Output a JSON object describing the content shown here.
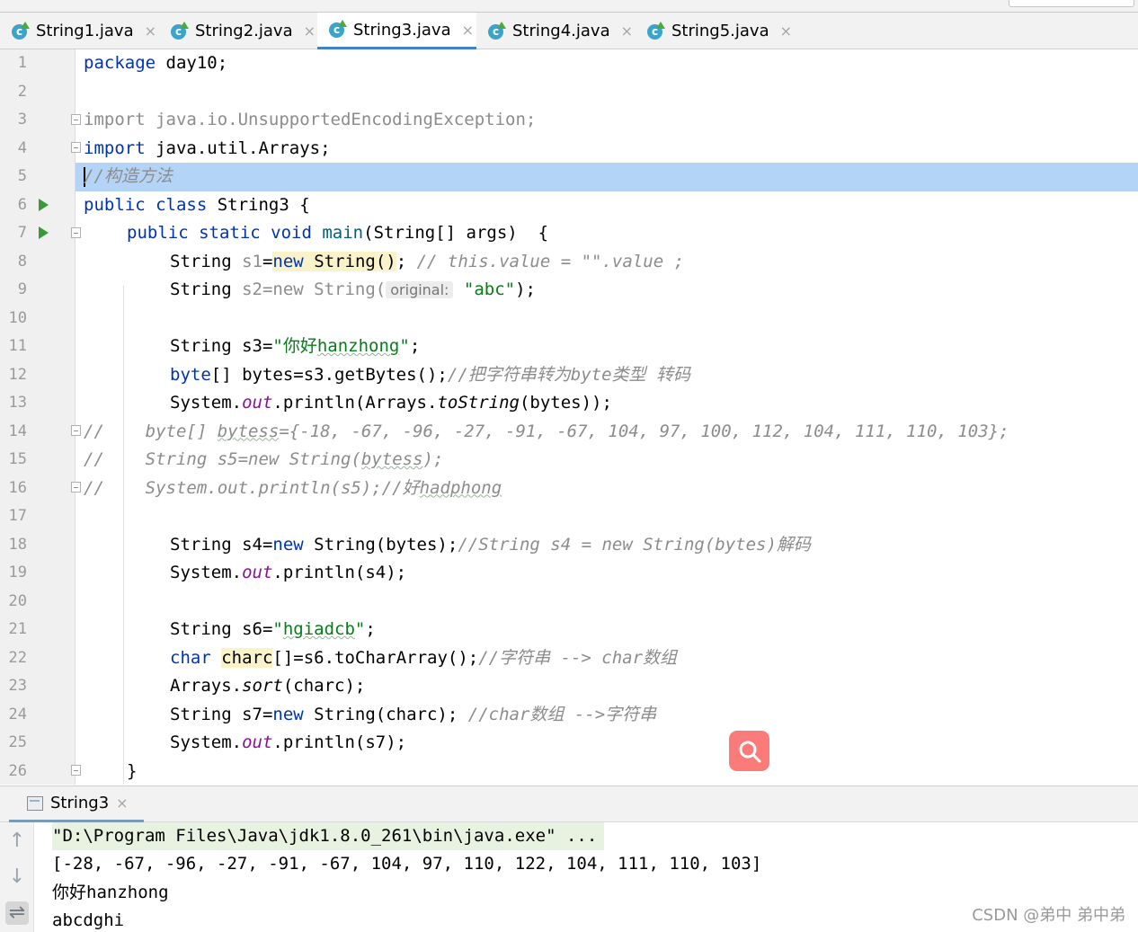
{
  "tabs": [
    {
      "label": "String1.java",
      "active": false
    },
    {
      "label": "String2.java",
      "active": false
    },
    {
      "label": "String3.java",
      "active": true
    },
    {
      "label": "String4.java",
      "active": false
    },
    {
      "label": "String5.java",
      "active": false
    }
  ],
  "tab_close_glyph": "×",
  "line_numbers": [
    "1",
    "2",
    "3",
    "4",
    "5",
    "6",
    "7",
    "8",
    "9",
    "10",
    "11",
    "12",
    "13",
    "14",
    "15",
    "16",
    "17",
    "18",
    "19",
    "20",
    "21",
    "22",
    "23",
    "24",
    "25",
    "26"
  ],
  "code": {
    "l1": {
      "kw": "package",
      "rest": " day10;"
    },
    "l3": {
      "kw": "import",
      "rest": " java.io.UnsupportedEncodingException;"
    },
    "l4": {
      "kw": "import",
      "rest": " java.util.Arrays;"
    },
    "l5": {
      "comment": "//构造方法"
    },
    "l6": {
      "kw": "public class",
      "rest": " String3 {"
    },
    "l7": {
      "kw": "public static void",
      "name": "main",
      "rest": "(String[] args)  {"
    },
    "l8": {
      "a": "String ",
      "var": "s1",
      "b": "=",
      "kw": "new",
      "hl": " String()",
      "c": "; ",
      "comment": "// this.value = \"\".value ;"
    },
    "l9": {
      "a": "String ",
      "var": "s2",
      "b": "=new String(",
      "hint": "original:",
      "str": "\"abc\"",
      "c": ");"
    },
    "l11": {
      "a": "String s3=",
      "str1": "\"你好",
      "str2": "hanzhong",
      "str3": "\"",
      "c": ";"
    },
    "l12": {
      "kw": "byte",
      "a": "[] bytes=s3.getBytes();",
      "comment": "//把字符串转为byte类型 转码"
    },
    "l13": {
      "a": "System.",
      "field": "out",
      "b": ".println(Arrays.",
      "ital": "toString",
      "c": "(bytes));"
    },
    "l14": {
      "prefix": "//",
      "a": "    byte[] ",
      "sq": "bytess",
      "b": "={-18, -67, -96, -27, -91, -67, 104, 97, 100, 112, 104, 111, 110, 103};"
    },
    "l15": {
      "prefix": "//",
      "a": "    String s5=new String(",
      "sq": "bytess",
      "b": ");"
    },
    "l16": {
      "prefix": "//",
      "a": "    System.out.println(s5);//好",
      "sq": "hadphong"
    },
    "l18": {
      "a": "String s4=",
      "kw": "new",
      "b": " String(bytes);",
      "comment": "//String s4 = new String(bytes)解码"
    },
    "l19": {
      "a": "System.",
      "field": "out",
      "b": ".println(s4);"
    },
    "l21": {
      "a": "String s6=",
      "str1": "\"",
      "str2": "hgiadcb",
      "str3": "\"",
      "c": ";"
    },
    "l22": {
      "kw": "char",
      "sp": " ",
      "hl": "charc",
      "a": "[]=s6.toCharArray();",
      "comment": "//字符串 --> char数组"
    },
    "l23": {
      "a": "Arrays.",
      "ital": "sort",
      "b": "(charc);"
    },
    "l24": {
      "a": "String s7=",
      "kw": "new",
      "b": " String(charc); ",
      "comment": "//char数组 -->字符串"
    },
    "l25": {
      "a": "System.",
      "field": "out",
      "b": ".println(s7);"
    },
    "l26": {
      "a": "}"
    }
  },
  "run_panel": {
    "tab_label": "String3",
    "console_lines": [
      "\"D:\\Program Files\\Java\\jdk1.8.0_261\\bin\\java.exe\" ...",
      "[-28, -67, -96, -27, -91, -67, 104, 97, 110, 122, 104, 111, 110, 103]",
      "你好hanzhong",
      "abcdghi"
    ]
  },
  "watermark": "CSDN @弟中 弟中弟",
  "colors": {
    "accent": "#4083c9",
    "keyword": "#0033b3",
    "string": "#067d17",
    "comment": "#8c8c8c",
    "field": "#871094",
    "caret_row": "#b3d4f7",
    "search_button": "#fb7a7a"
  },
  "icons": {
    "tab_file": "java-class-icon",
    "run": "run-gutter-icon",
    "search": "search-icon"
  }
}
